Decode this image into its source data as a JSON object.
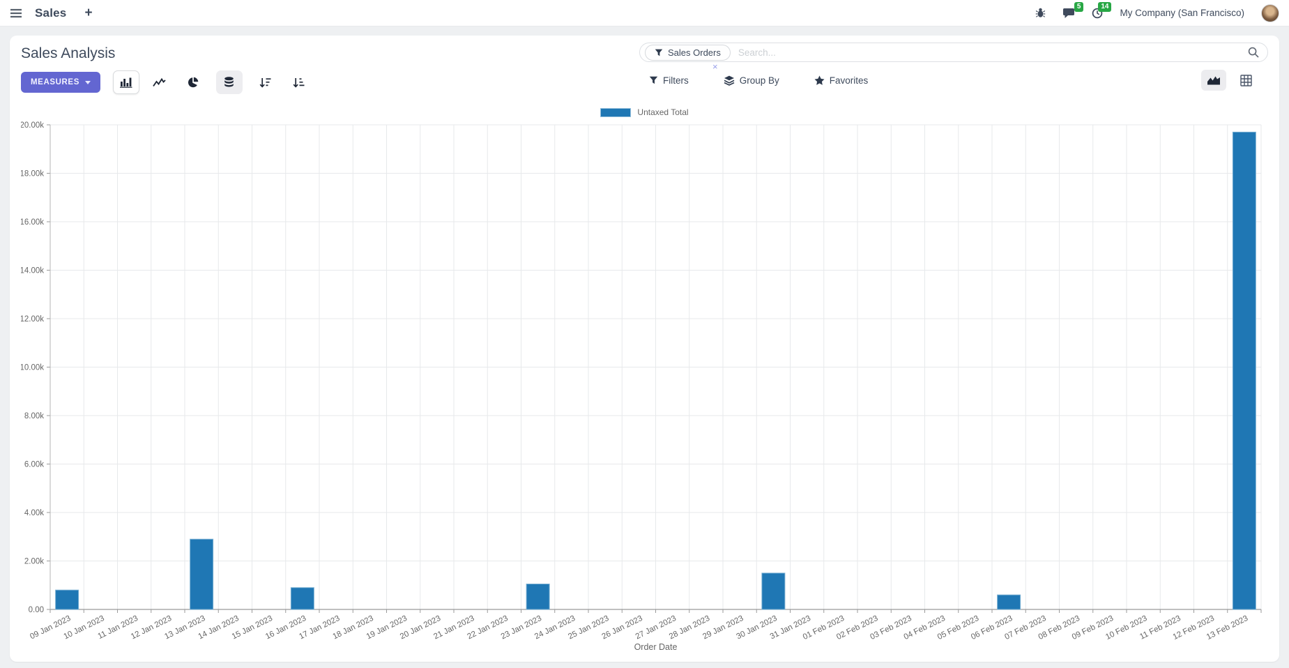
{
  "navbar": {
    "app_name": "Sales",
    "plus_label": "+",
    "messages_badge": "5",
    "activities_badge": "14",
    "company": "My Company (San Francisco)"
  },
  "control_panel": {
    "title": "Sales Analysis",
    "measures_label": "MEASURES",
    "search": {
      "facet_label": "Sales Orders",
      "remove_facet": "×",
      "placeholder": "Search..."
    },
    "filters_label": "Filters",
    "group_by_label": "Group By",
    "favorites_label": "Favorites"
  },
  "colors": {
    "accent": "#6366d1",
    "bar": "#1f77b4",
    "badge_green": "#28a745"
  },
  "chart_data": {
    "type": "bar",
    "title": "",
    "xlabel": "Order Date",
    "ylabel": "",
    "ylim": [
      0,
      20000
    ],
    "ytick_step": 2000,
    "ytick_labels": [
      "0.00",
      "2.00k",
      "4.00k",
      "6.00k",
      "8.00k",
      "10.00k",
      "12.00k",
      "14.00k",
      "16.00k",
      "18.00k",
      "20.00k"
    ],
    "grid": true,
    "legend_position": "top",
    "categories": [
      "09 Jan 2023",
      "10 Jan 2023",
      "11 Jan 2023",
      "12 Jan 2023",
      "13 Jan 2023",
      "14 Jan 2023",
      "15 Jan 2023",
      "16 Jan 2023",
      "17 Jan 2023",
      "18 Jan 2023",
      "19 Jan 2023",
      "20 Jan 2023",
      "21 Jan 2023",
      "22 Jan 2023",
      "23 Jan 2023",
      "24 Jan 2023",
      "25 Jan 2023",
      "26 Jan 2023",
      "27 Jan 2023",
      "28 Jan 2023",
      "29 Jan 2023",
      "30 Jan 2023",
      "31 Jan 2023",
      "01 Feb 2023",
      "02 Feb 2023",
      "03 Feb 2023",
      "04 Feb 2023",
      "05 Feb 2023",
      "06 Feb 2023",
      "07 Feb 2023",
      "08 Feb 2023",
      "09 Feb 2023",
      "10 Feb 2023",
      "11 Feb 2023",
      "12 Feb 2023",
      "13 Feb 2023"
    ],
    "series": [
      {
        "name": "Untaxed Total",
        "color": "#1f77b4",
        "values": [
          800,
          0,
          0,
          0,
          2900,
          0,
          0,
          900,
          0,
          0,
          0,
          0,
          0,
          0,
          1050,
          0,
          0,
          0,
          0,
          0,
          0,
          1500,
          0,
          0,
          0,
          0,
          0,
          0,
          600,
          0,
          0,
          0,
          0,
          0,
          0,
          19700
        ]
      }
    ]
  }
}
